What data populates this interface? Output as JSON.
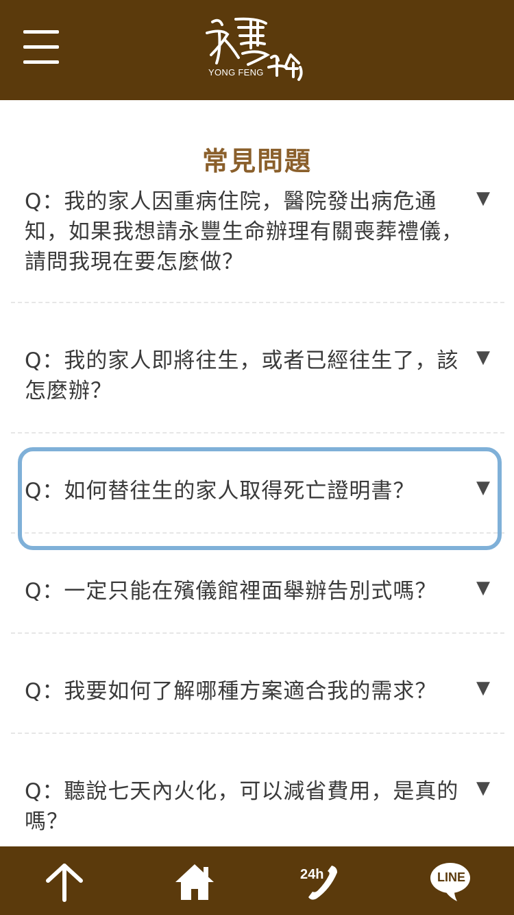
{
  "header": {
    "menu_icon": "hamburger-menu-icon",
    "logo_mark": "永豐生命",
    "logo_sub": "YONG FENG"
  },
  "page": {
    "title": "常見問題"
  },
  "faq": [
    {
      "q": "Q：我的家人因重病住院，醫院發出病危通知，如果我想請永豐生命辦理有關喪葬禮儀， 請問我現在要怎麼做？",
      "arrow": "▼"
    },
    {
      "q": "Q：我的家人即將往生，或者已經往生了，該怎麼辦？",
      "arrow": "▼"
    },
    {
      "q": "Q：如何替往生的家人取得死亡證明書？",
      "arrow": "▼"
    },
    {
      "q": "Q：一定只能在殯儀館裡面舉辦告別式嗎？",
      "arrow": "▼"
    },
    {
      "q": "Q：我要如何了解哪種方案適合我的需求？",
      "arrow": "▼"
    },
    {
      "q": "Q：聽說七天內火化，可以減省費用，是真的嗎？",
      "arrow": "▼"
    }
  ],
  "footer": {
    "icons": [
      "arrow-up-icon",
      "home-icon",
      "phone-24h-icon",
      "line-chat-icon"
    ],
    "phone_label": "24h",
    "line_label": "LINE"
  },
  "colors": {
    "brand_brown": "#5b3a0c",
    "title_brown": "#8a5f2b",
    "highlight_blue": "#7fb0d8"
  }
}
